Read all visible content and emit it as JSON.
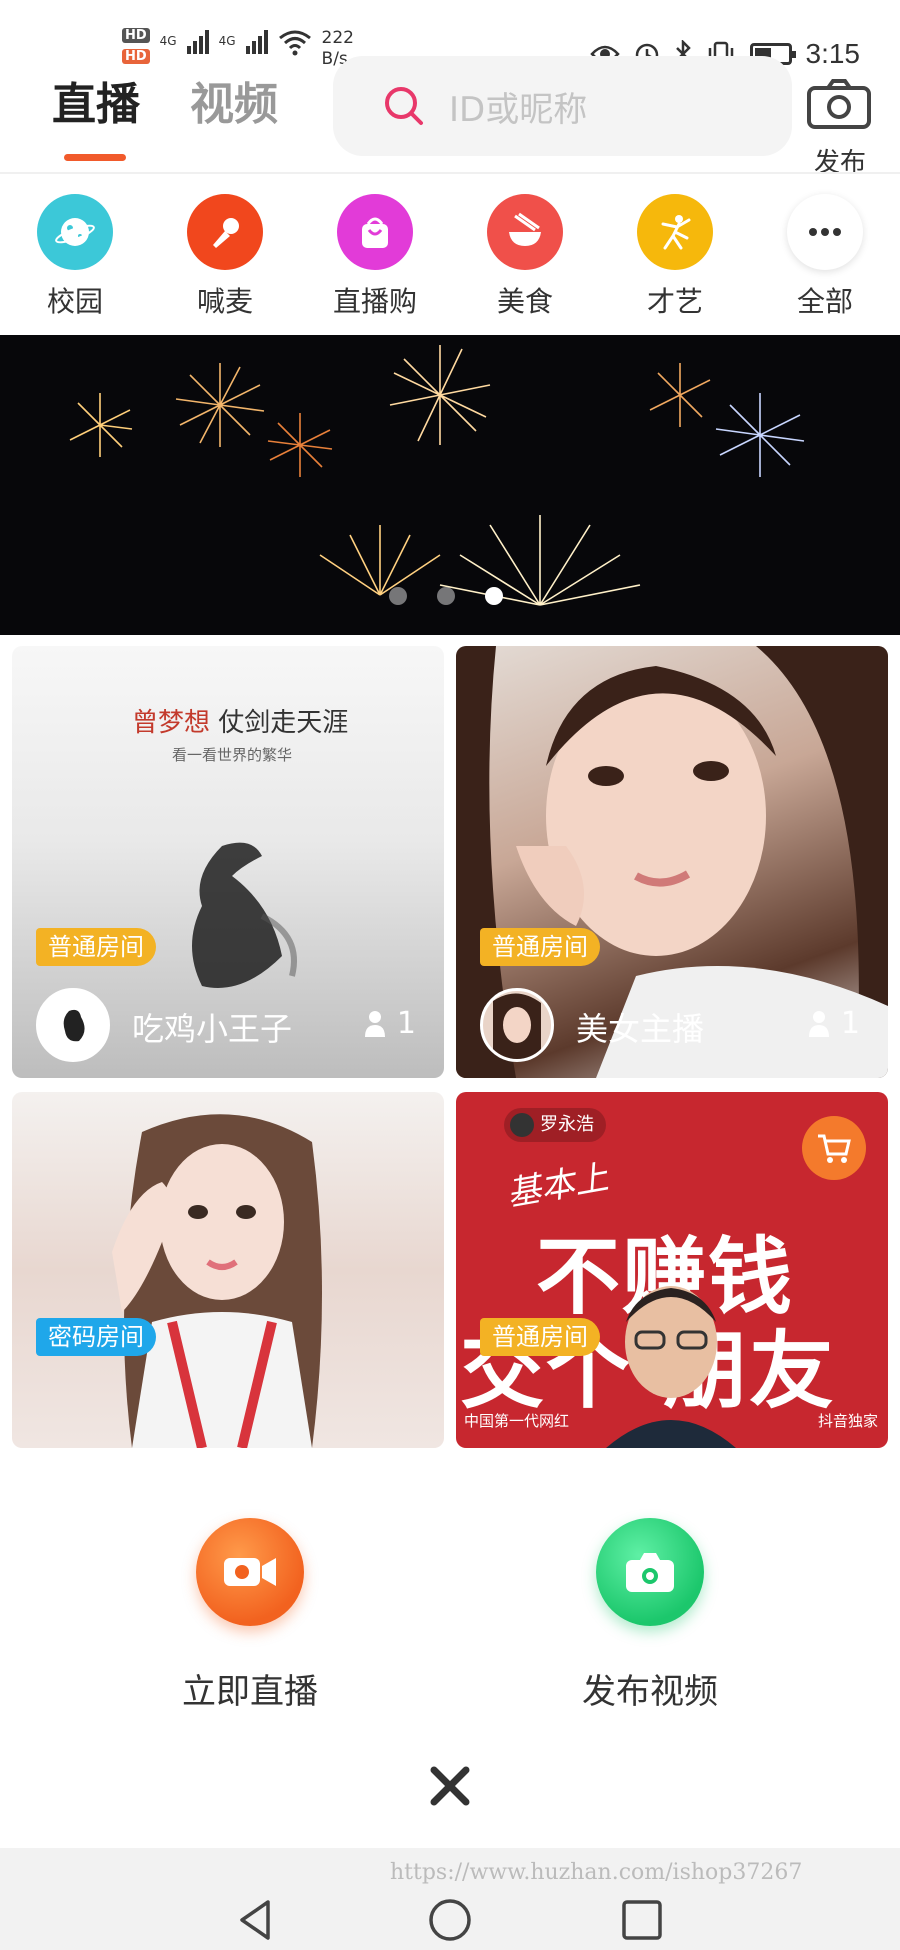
{
  "status_bar": {
    "hd1": "HD",
    "hd2": "HD",
    "net1": "4G",
    "net2": "4G",
    "speed_value": "222",
    "speed_unit": "B/s",
    "time": "3:15"
  },
  "header": {
    "tabs": [
      {
        "label": "直播",
        "active": true
      },
      {
        "label": "视频",
        "active": false
      }
    ],
    "search_placeholder": "ID或昵称",
    "publish_label": "发布",
    "accent_color": "#f15a2b"
  },
  "categories": [
    {
      "label": "校园",
      "icon": "planet-icon",
      "color": "#3cc8d8"
    },
    {
      "label": "喊麦",
      "icon": "microphone-icon",
      "color": "#f1471d"
    },
    {
      "label": "直播购",
      "icon": "shopping-bag-icon",
      "color": "#e23bd8"
    },
    {
      "label": "美食",
      "icon": "bowl-chopsticks-icon",
      "color": "#f0504a"
    },
    {
      "label": "才艺",
      "icon": "dancer-icon",
      "color": "#f6b80c"
    },
    {
      "label": "全部",
      "icon": "more-dots-icon",
      "color": "#ffffff"
    }
  ],
  "banner": {
    "slide_count": 3,
    "active_index": 2
  },
  "rooms": [
    {
      "badge": "普通房间",
      "name": "吃鸡小王子",
      "viewers": "1",
      "poster_title_red": "曾梦想",
      "poster_title_rest": " 仗剑走天涯",
      "poster_subtitle": "看一看世界的繁华"
    },
    {
      "badge": "普通房间",
      "name": "美女主播",
      "viewers": "1"
    },
    {
      "badge": "密码房间"
    },
    {
      "badge": "普通房间",
      "poster_name": "罗永浩",
      "poster_basic": "基本上",
      "poster_line1": "不赚钱",
      "poster_line2": "交个 朋友",
      "poster_footer_left": "中国第一代网红",
      "poster_footer_right": "抖音独家"
    }
  ],
  "sheet": {
    "go_live_label": "立即直播",
    "post_video_label": "发布视频"
  },
  "watermark": "https://www.huzhan.com/ishop37267"
}
